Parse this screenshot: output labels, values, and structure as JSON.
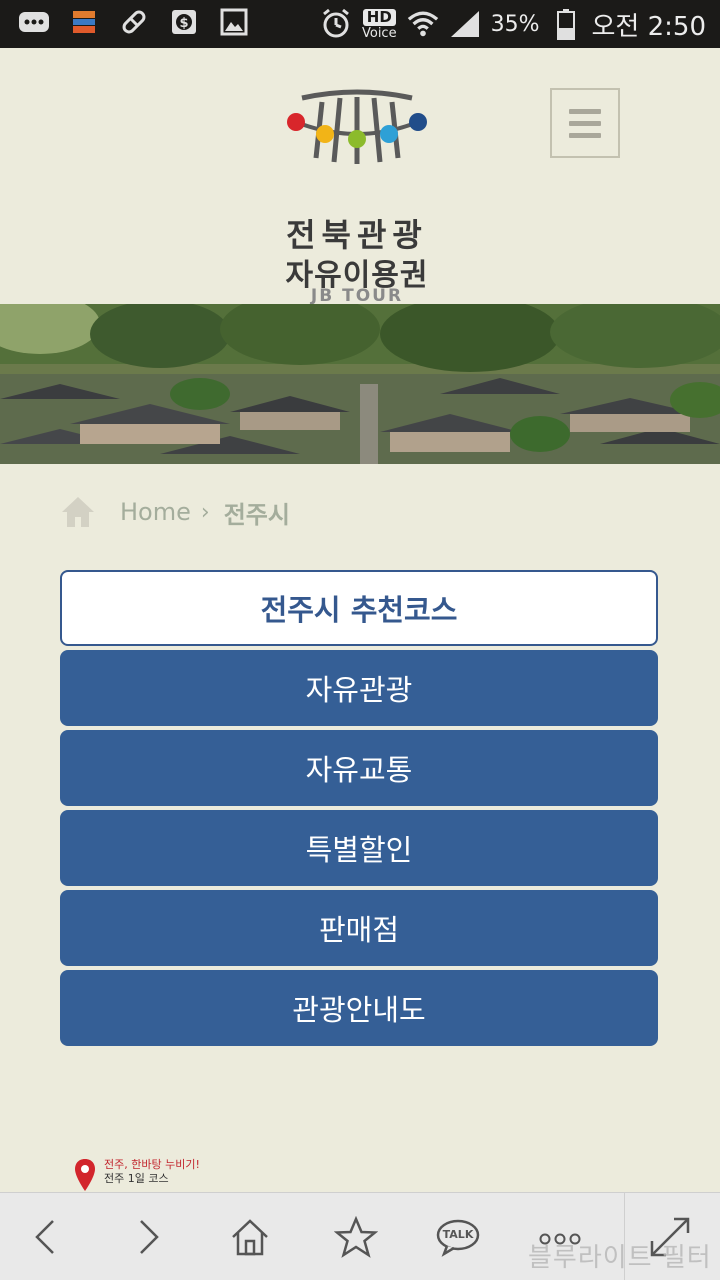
{
  "status_bar": {
    "battery_percent": "35%",
    "time": "오전 2:50",
    "hd_label": "HD",
    "voice_label": "Voice",
    "icons": [
      "chat-icon",
      "app-icon",
      "pill-icon",
      "dollar-icon",
      "image-icon",
      "alarm-icon",
      "hd-voice-icon",
      "wifi-icon",
      "signal-icon",
      "battery-icon"
    ]
  },
  "header": {
    "logo_line1": "전북관광",
    "logo_line2": "자유이용권",
    "logo_line3": "JB TOUR PASS",
    "logo_dot_colors": [
      "#d8262b",
      "#f2b417",
      "#8cbb2c",
      "#2ea0d6",
      "#214d8a"
    ],
    "menu_icon": "hamburger-icon"
  },
  "breadcrumb": {
    "home": "Home",
    "separator": "›",
    "current": "전주시"
  },
  "menu": {
    "items": [
      {
        "label": "전주시 추천코스",
        "active": true
      },
      {
        "label": "자유관광",
        "active": false
      },
      {
        "label": "자유교통",
        "active": false
      },
      {
        "label": "특별할인",
        "active": false
      },
      {
        "label": "판매점",
        "active": false
      },
      {
        "label": "관광안내도",
        "active": false
      }
    ]
  },
  "course_label": {
    "line1": "전주, 한바탕 누비기!",
    "line2": "전주 1일 코스"
  },
  "bottom_nav": {
    "icons": [
      "back-arrow-icon",
      "forward-arrow-icon",
      "home-icon",
      "star-icon",
      "talk-icon",
      "more-icon",
      "expand-icon"
    ],
    "talk_label": "TALK"
  },
  "watermark": "블루라이트 필터",
  "colors": {
    "background": "#ecebdc",
    "button_blue": "#355f96",
    "status_bar": "#1b1a18"
  }
}
